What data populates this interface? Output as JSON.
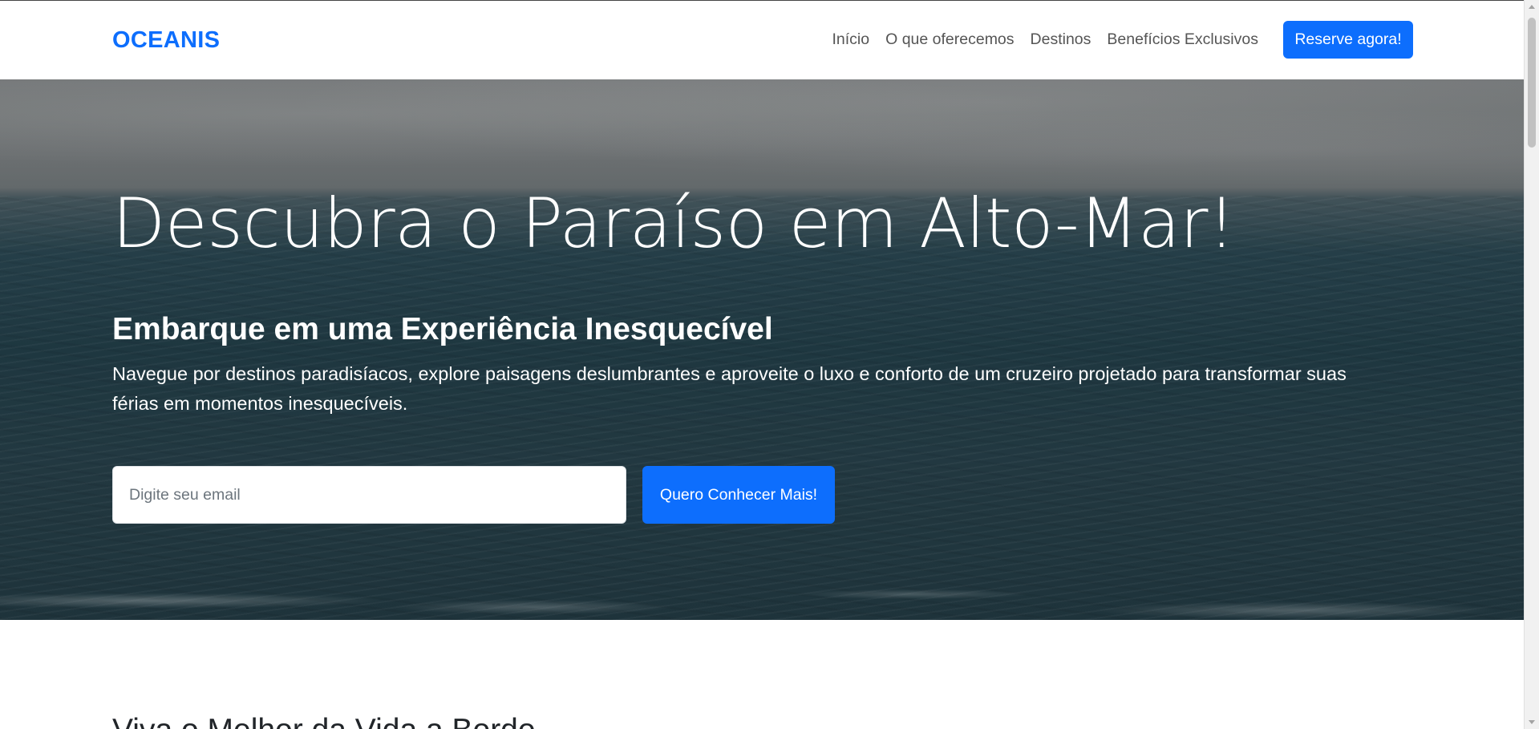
{
  "navbar": {
    "brand": "OCEANIS",
    "links": [
      "Início",
      "O que oferecemos",
      "Destinos",
      "Benefícios Exclusivos"
    ],
    "cta_label": "Reserve agora!"
  },
  "hero": {
    "title": "Descubra o Paraíso em Alto-Mar!",
    "subtitle": "Embarque em uma Experiência Inesquecível",
    "text": "Navegue por destinos paradisíacos, explore paisagens deslumbrantes e aproveite o luxo e conforto de um cruzeiro projetado para transformar suas férias em momentos inesquecíveis.",
    "email_placeholder": "Digite seu email",
    "email_value": "",
    "submit_label": "Quero Conhecer Mais!"
  },
  "next_section": {
    "title": "Viva o Melhor da Vida a Bordo"
  },
  "colors": {
    "accent": "#0d6efd",
    "hero_sea": "#274753",
    "hero_sky": "#858a8c"
  }
}
